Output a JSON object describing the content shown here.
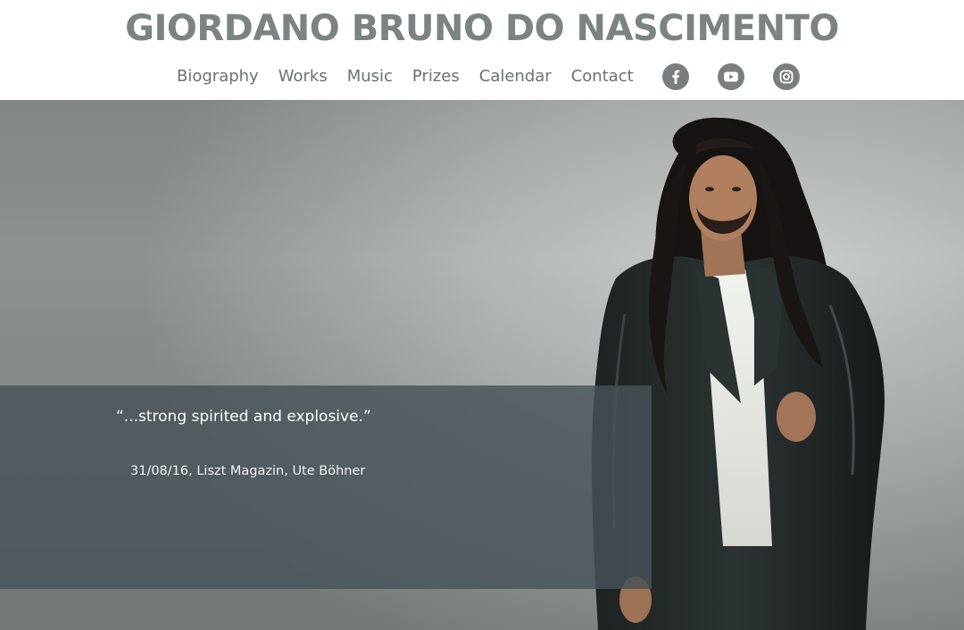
{
  "header": {
    "title": "GIORDANO BRUNO DO NASCIMENTO",
    "nav": [
      {
        "label": "Biography"
      },
      {
        "label": "Works"
      },
      {
        "label": "Music"
      },
      {
        "label": "Prizes"
      },
      {
        "label": "Calendar"
      },
      {
        "label": "Contact"
      }
    ],
    "social": [
      "facebook-icon",
      "youtube-icon",
      "instagram-icon"
    ],
    "social_color": "#7a7e7e"
  },
  "hero": {
    "quote": "“...strong spirited and explosive.”",
    "source": "31/08/16, Liszt Magazin, Ute Böhner",
    "overlay_color": "#485258"
  }
}
